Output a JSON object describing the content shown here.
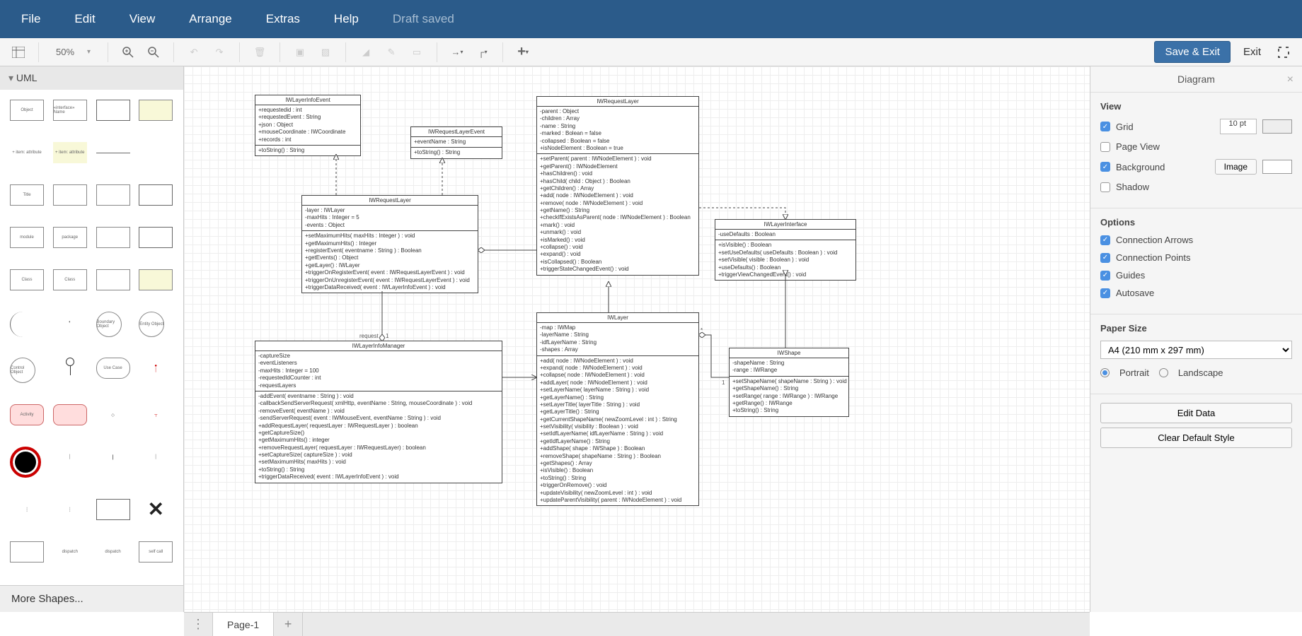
{
  "menubar": {
    "file": "File",
    "edit": "Edit",
    "view": "View",
    "arrange": "Arrange",
    "extras": "Extras",
    "help": "Help",
    "draft": "Draft saved"
  },
  "toolbar": {
    "zoom": "50%",
    "save_exit": "Save & Exit",
    "exit": "Exit"
  },
  "sidebar": {
    "header": "UML",
    "more": "More Shapes...",
    "shape_labels": [
      "Object",
      "«interface» Name",
      "",
      "",
      "+ item: attribute",
      "+ item: attribute",
      "",
      "",
      "Title",
      "",
      "",
      "",
      "module",
      "package",
      "",
      "",
      "Class",
      "Class",
      "",
      "",
      "",
      "",
      "Boundary Object",
      "Entity Object",
      "Control Object",
      "",
      "Use Case",
      "",
      "Activity",
      "",
      "",
      "",
      "",
      "",
      "",
      "",
      "",
      "",
      "",
      "",
      "",
      "dispatch",
      "dispatch",
      "self call"
    ]
  },
  "pages": {
    "page1": "Page-1"
  },
  "format": {
    "title": "Diagram",
    "view": "View",
    "grid": "Grid",
    "grid_pt": "10 pt",
    "pageview": "Page View",
    "background": "Background",
    "image": "Image",
    "shadow": "Shadow",
    "options": "Options",
    "conn_arrows": "Connection Arrows",
    "conn_points": "Connection Points",
    "guides": "Guides",
    "autosave": "Autosave",
    "paper": "Paper Size",
    "paper_sel": "A4 (210 mm x 297 mm)",
    "portrait": "Portrait",
    "landscape": "Landscape",
    "editdata": "Edit Data",
    "cleardef": "Clear Default Style"
  },
  "uml": {
    "c1": {
      "name": "IWLayerInfoEvent",
      "attrs": "+requestedid : int\n+requestedEvent : String\n+json : Object\n+mouseCoordinate : IWCoordinate\n+records : int",
      "ops": "+toString() : String"
    },
    "c2": {
      "name": "IWRequestLayerEvent",
      "attrs": "+eventName : String",
      "ops": "+toString() : String"
    },
    "c3": {
      "name": "IWRequestLayer",
      "attrs": "-layer : IWLayer\n-maxHits : Integer = 5\n-events : Object",
      "ops": "+setMaximumHits( maxHits : Integer ) : void\n+getMaximumHits() : Integer\n+registerEvent( eventname : String ) : Boolean\n+getEvents() : Object\n+getLayer() : IWLayer\n+triggerOnRegisterEvent( event : IWRequestLayerEvent ) : void\n+triggerOnUnregisterEvent( event : IWRequestLayerEvent ) : void\n+triggerDataReceived( event : IWLayerInfoEvent ) : void"
    },
    "c4": {
      "name": "IWRequestLayer",
      "attrs": "-parent : Object\n-children : Array\n-name : String\n-marked : Bolean = false\n-collapsed : Boolean = false\n+isNodeElement : Boolean = true",
      "ops": "+setParent( parent : IWNodeElement ) : void\n+getParent() : IWNodeElement\n+hasChildren() : void\n+hasChild( child : Object ) : Boolean\n+getChildren() : Array\n+add( node : IWNodeElement ) : void\n+remove( node : IWNodeElement ) : void\n+getName() : String\n+checkIfExistsAsParent( node : IWNodeElement ) : Boolean\n+mark() : void\n+unmark() : void\n+isMarked() : void\n+collapse() : void\n+expand() : void\n+isCollapsed() : Boolean\n+triggerStateChangedEvent() : void"
    },
    "c5": {
      "name": "IWLayerInterface",
      "attrs": "-useDefaults : Boolean",
      "ops": "+isVisible() : Boolean\n+setUseDefaults( useDefaults : Boolean ) : void\n+setVisible( visible : Boolean ) : void\n+useDefaults() : Boolean\n+triggerViewChangedEvent() : void"
    },
    "c6": {
      "name": "IWLayer",
      "attrs": "-map : IWMap\n-layerName : String\n-idfLayerName : String\n-shapes : Array",
      "ops": "+add( node : IWNodeElement ) : void\n+expand( node : IWNodeElement ) : void\n+collapse( node : IWNodeElement ) : void\n+addLayer( node : IWNodeElement ) : void\n+setLayerName( layerName : String ) : void\n+getLayerName() : String\n+setLayerTitle( layerTitle : String ) : void\n+getLayerTitle() : String\n+getCurrentShapeName( newZoomLevel : int ) : String\n+setVisibility( visibility : Boolean ) : void\n+setIdfLayerName( idfLayerName : String ) : void\n+getIdfLayerName() : String\n+addShape( shape : IWShape ) : Boolean\n+removeShape( shapeName : String ) : Boolean\n+getShapes() : Array\n+isVisible() : Boolean\n+toString() : String\n+triggerOnRemove() : void\n+updateVisibility( newZoomLevel : int ) : void\n+updateParentVisibility( parent : IWNodeElement ) : void"
    },
    "c7": {
      "name": "IWShape",
      "attrs": "-shapeName : String\n-range : IWRange",
      "ops": "+setShapeName( shapeName : String ) : void\n+getShapeName() : String\n+setRange( range : IWRange ) : IWRange\n+getRange() : IWRange\n+toString() : String"
    },
    "c8": {
      "name": "IWLayerInfoManager",
      "attrs": "-captureSize\n-eventListeners\n-maxHits : Integer = 100\n-requestedIdCounter : int\n-requestLayers",
      "ops": "-addEvent( eventname : String ) : void\n-callbackSendServerRequest( xmlHttp, eventName : String, mouseCoordinate ) : void\n-removeEvent( eventName ) : void\n-sendServerRequest( event : IWMouseEvent, eventName : String ) : void\n+addRequestLayer( requestLayer : IWRequestLayer ) : boolean\n+getCaptureSize()\n+getMaximumHits() : integer\n+removeRequestLayer( requestLayer : IWRequestLayer) : boolean\n+setCaptureSize( captureSize ) : void\n+setMaximumHits( maxHits ) : void\n+toString() : String\n+triggerDataReceived( event : IWLayerInfoEvent ) : void"
    },
    "edge_label": "request"
  }
}
